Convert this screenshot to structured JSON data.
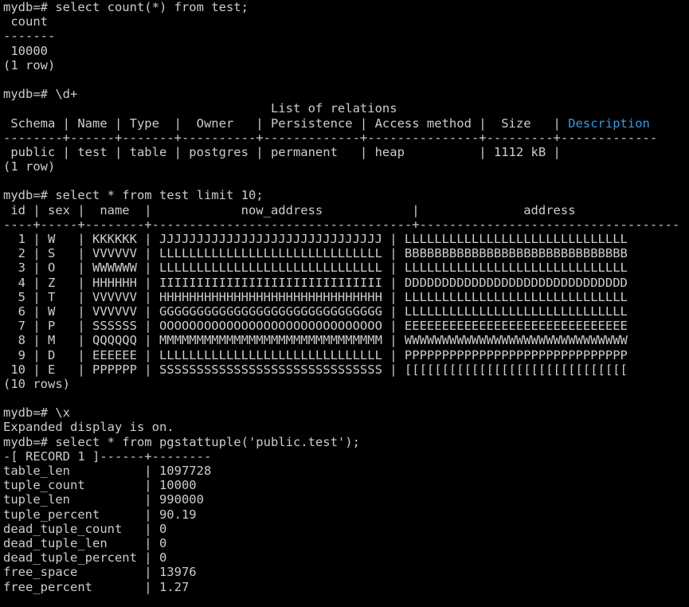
{
  "terminal": {
    "lines": [
      "mydb=# select count(*) from test;",
      " count",
      "-------",
      " 10000",
      "(1 row)",
      "",
      "mydb=# \\d+",
      "                                    List of relations",
      " Schema | Name | Type  |  Owner   | Persistence | Access method |  Size   | ",
      "--------+------+-------+----------+-------------+---------------+---------+-------------",
      " public | test | table | postgres | permanent   | heap          | 1112 kB |",
      "(1 row)",
      "",
      "mydb=# select * from test limit 10;",
      " id | sex |  name  |            now_address            |              address",
      "----+-----+--------+-----------------------------------+-----------------------------------",
      "  1 | W   | KKKKKK | JJJJJJJJJJJJJJJJJJJJJJJJJJJJJJ | LLLLLLLLLLLLLLLLLLLLLLLLLLLLLL",
      "  2 | S   | VVVVVV | LLLLLLLLLLLLLLLLLLLLLLLLLLLLLL | BBBBBBBBBBBBBBBBBBBBBBBBBBBBBB",
      "  3 | O   | WWWWWW | LLLLLLLLLLLLLLLLLLLLLLLLLLLLLL | LLLLLLLLLLLLLLLLLLLLLLLLLLLLLL",
      "  4 | Z   | HHHHHH | IIIIIIIIIIIIIIIIIIIIIIIIIIIIII | DDDDDDDDDDDDDDDDDDDDDDDDDDDDDD",
      "  5 | T   | VVVVVV | HHHHHHHHHHHHHHHHHHHHHHHHHHHHHH | LLLLLLLLLLLLLLLLLLLLLLLLLLLLLL",
      "  6 | W   | VVVVVV | GGGGGGGGGGGGGGGGGGGGGGGGGGGGGG | LLLLLLLLLLLLLLLLLLLLLLLLLLLLLL",
      "  7 | P   | SSSSSS | OOOOOOOOOOOOOOOOOOOOOOOOOOOOOO | EEEEEEEEEEEEEEEEEEEEEEEEEEEEEE",
      "  8 | M   | QQQQQQ | MMMMMMMMMMMMMMMMMMMMMMMMMMMMMM | WWWWWWWWWWWWWWWWWWWWWWWWWWWWWW",
      "  9 | D   | EEEEEE | LLLLLLLLLLLLLLLLLLLLLLLLLLLLLL | PPPPPPPPPPPPPPPPPPPPPPPPPPPPPP",
      " 10 | E   | PPPPPP | SSSSSSSSSSSSSSSSSSSSSSSSSSSSSS | [[[[[[[[[[[[[[[[[[[[[[[[[[[[[[",
      "(10 rows)",
      "",
      "mydb=# \\x",
      "Expanded display is on.",
      "mydb=# select * from pgstattuple('public.test');",
      "-[ RECORD 1 ]------+--------",
      "table_len          | 1097728",
      "tuple_count        | 10000",
      "tuple_len          | 990000",
      "tuple_percent      | 90.19",
      "dead_tuple_count   | 0",
      "dead_tuple_len     | 0",
      "dead_tuple_percent | 0",
      "free_space         | 13976",
      "free_percent       | 1.27"
    ],
    "highlight": {
      "line_index": 8,
      "text": "Description",
      "color": "#3a96dd"
    },
    "colors": {
      "background": "#000000",
      "foreground": "#cccccc"
    }
  }
}
